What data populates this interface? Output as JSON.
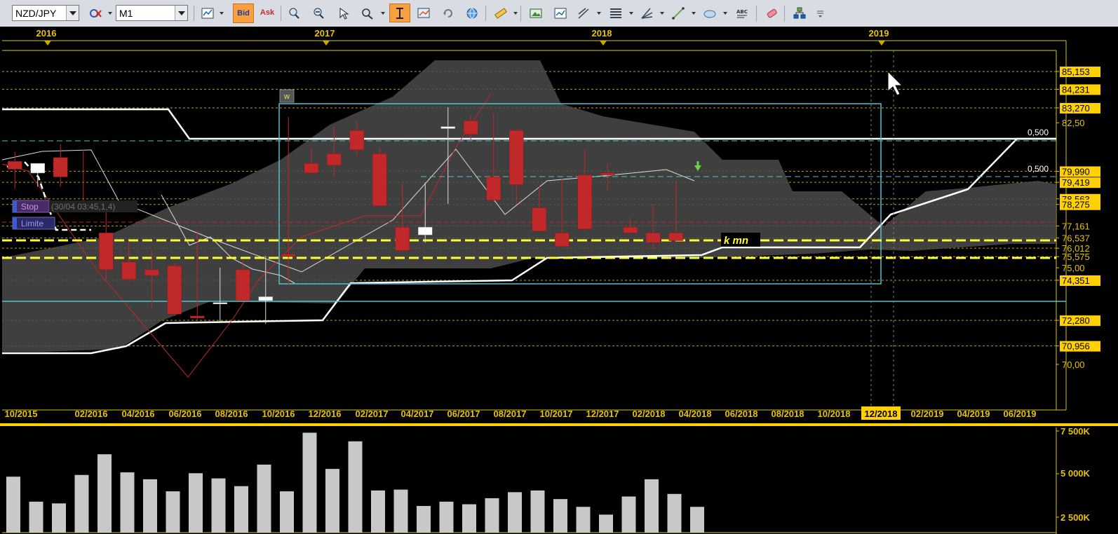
{
  "toolbar": {
    "symbol": "NZD/JPY",
    "timeframe": "M1",
    "bid_label": "Bid",
    "ask_label": "Ask",
    "icons": [
      "chart-type-icon",
      "crosshair-icon",
      "zoom-in-icon",
      "zoom-out-icon",
      "cursor-icon",
      "zoom-icon",
      "vertical-line-icon",
      "chart-properties-icon",
      "refresh-icon",
      "globe-icon",
      "ruler-icon",
      "image-icon",
      "template-icon",
      "trendline-tools-icon",
      "fibonacci-icon",
      "channel-icon",
      "line-icon",
      "ellipse-icon",
      "text-icon",
      "eraser-icon",
      "indicators-icon",
      "menu-icon"
    ]
  },
  "chart": {
    "year_labels": [
      "2016",
      "2017",
      "2018",
      "2019"
    ],
    "month_labels": [
      "10/2015",
      "02/2016",
      "04/2016",
      "06/2016",
      "08/2016",
      "10/2016",
      "12/2016",
      "02/2017",
      "04/2017",
      "06/2017",
      "08/2017",
      "10/2017",
      "12/2017",
      "02/2018",
      "04/2018",
      "06/2018",
      "08/2018",
      "10/2018",
      "12/2018",
      "02/2019",
      "04/2019",
      "06/2019"
    ],
    "highlighted_month": "12/2018",
    "price_labels": [
      {
        "text": "85,153",
        "boxed": true
      },
      {
        "text": "84,231",
        "boxed": true
      },
      {
        "text": "83,270",
        "boxed": true
      },
      {
        "text": "82,50",
        "boxed": false
      },
      {
        "text": "79,990",
        "boxed": true
      },
      {
        "text": "79,419",
        "boxed": true
      },
      {
        "text": "78,563",
        "boxed": true
      },
      {
        "text": "78,275",
        "boxed": true
      },
      {
        "text": "77,161",
        "boxed": false
      },
      {
        "text": "76,537",
        "boxed": false
      },
      {
        "text": "76,012",
        "boxed": false
      },
      {
        "text": "75,575",
        "boxed": false
      },
      {
        "text": "75,00",
        "boxed": false
      },
      {
        "text": "74,351",
        "boxed": true
      },
      {
        "text": "72,280",
        "boxed": true
      },
      {
        "text": "70,956",
        "boxed": true
      },
      {
        "text": "70,00",
        "boxed": false
      }
    ],
    "fib_labels": [
      "0,500",
      "0,500"
    ],
    "annotation": "k mn",
    "marker_label": "w",
    "order_labels": {
      "stop": "Stop",
      "limit": "Limite",
      "info": "(30/04 03:45,1,4)"
    },
    "volume_labels": [
      "7 500K",
      "5 000K",
      "2 500K"
    ],
    "colors": {
      "bull": "#ffffff",
      "bear": "#c0282a",
      "grid": "#d9c800",
      "cloud": "#4a4a4a",
      "rect": "#4fc3d0",
      "label_bg": "#ffd100"
    }
  },
  "chart_data": {
    "type": "candlestick",
    "symbol": "NZD/JPY",
    "x": [
      "11/2015",
      "12/2015",
      "01/2016",
      "02/2016",
      "03/2016",
      "04/2016",
      "05/2016",
      "06/2016",
      "07/2016",
      "08/2016",
      "09/2016",
      "10/2016",
      "11/2016",
      "12/2016",
      "01/2017",
      "02/2017",
      "03/2017",
      "04/2017",
      "05/2017",
      "06/2017",
      "07/2017",
      "08/2017",
      "09/2017",
      "10/2017",
      "11/2017",
      "12/2017",
      "01/2018",
      "02/2018",
      "03/2018",
      "04/2018"
    ],
    "open": [
      80.5,
      79.9,
      80.7,
      78.4,
      76.8,
      75.3,
      74.9,
      75.1,
      72.5,
      73.2,
      74.9,
      73.3,
      75.7,
      80.4,
      80.9,
      82.1,
      80.9,
      77.1,
      76.7,
      82.2,
      82.6,
      79.7,
      82.1,
      78.1,
      76.8,
      79.8,
      79.9,
      77.1,
      76.8,
      76.8
    ],
    "high": [
      81.0,
      80.2,
      81.4,
      81.1,
      78.0,
      76.4,
      75.9,
      75.2,
      76.9,
      75.0,
      75.4,
      75.6,
      82.8,
      81.2,
      82.3,
      82.6,
      81.2,
      79.4,
      79.4,
      83.3,
      82.9,
      83.0,
      82.2,
      79.2,
      79.6,
      81.1,
      80.4,
      77.6,
      78.3,
      79.5
    ],
    "low": [
      79.1,
      79.2,
      79.2,
      78.2,
      74.3,
      74.4,
      72.9,
      72.5,
      72.3,
      72.2,
      73.6,
      72.1,
      74.1,
      80.0,
      79.7,
      80.8,
      78.3,
      75.8,
      76.3,
      78.3,
      81.6,
      78.4,
      78.3,
      77.4,
      76.7,
      76.9,
      79.0,
      76.9,
      75.9,
      76.7
    ],
    "close": [
      80.1,
      80.4,
      79.7,
      78.1,
      74.9,
      74.4,
      74.6,
      72.6,
      72.4,
      73.2,
      73.3,
      73.5,
      75.6,
      79.9,
      80.3,
      81.1,
      78.2,
      75.9,
      77.1,
      82.3,
      81.9,
      78.5,
      79.3,
      76.9,
      76.1,
      77.0,
      79.8,
      76.8,
      76.3,
      76.4
    ],
    "volume_k": [
      4850,
      3400,
      3300,
      4950,
      6150,
      5100,
      4700,
      4000,
      5050,
      4750,
      4300,
      5550,
      4000,
      7400,
      5300,
      6900,
      4050,
      4100,
      3150,
      3400,
      3250,
      3600,
      3950,
      4050,
      3550,
      3100,
      2650,
      3700,
      4700,
      3850,
      3100
    ],
    "ylim": [
      68.6,
      86.3
    ],
    "horizontal_levels": [
      85.153,
      84.231,
      83.27,
      79.99,
      79.419,
      78.563,
      78.275,
      77.161,
      76.537,
      76.012,
      75.575,
      74.351,
      72.28,
      70.956
    ],
    "indicators": [
      "Ichimoku cloud",
      "Donchian channel"
    ]
  }
}
